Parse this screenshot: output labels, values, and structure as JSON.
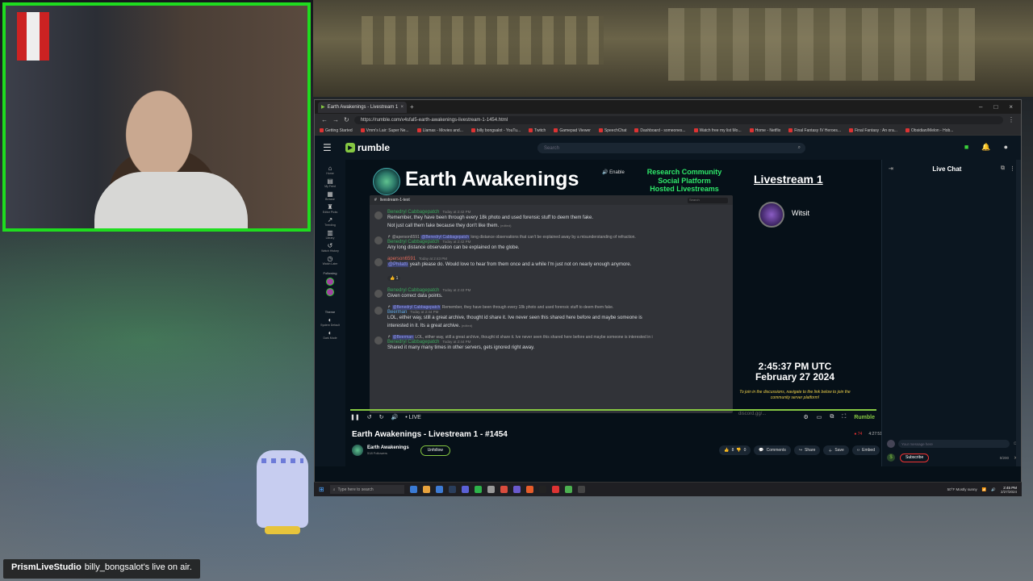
{
  "overlay": {
    "notice_app": "PrismLiveStudio",
    "notice_text": "billy_bongsalot's live on air."
  },
  "browser": {
    "tab_title": "Earth Awakenings - Livestream 1",
    "url": "https://rumble.com/v4sfal5-earth-awakenings-livestream-1-1454.html",
    "bookmarks": [
      "Getting Started",
      "Vmm's Lair: Super Ne...",
      "Llamas - Movies and...",
      "billy bongsalot - YouTu...",
      "Twitch",
      "Gamepad Viewer",
      "SpeechChat",
      "Dashboard - someones...",
      "Watch free my list Mo...",
      "Home - Netflix",
      "Final Fantasy IV Heroes...",
      "Final Fantasy : An ora...",
      "Obsidian/Melon - Hob..."
    ]
  },
  "rumble": {
    "logo": "rumble",
    "search_placeholder": "Search",
    "nav": [
      {
        "icon": "home-icon",
        "glyph": "⌂",
        "label": "Home"
      },
      {
        "icon": "library-icon",
        "glyph": "▤",
        "label": "My Feed"
      },
      {
        "icon": "browse-icon",
        "glyph": "▦",
        "label": "Browse"
      },
      {
        "icon": "editor-icon",
        "glyph": "♜",
        "label": "Editor Picks"
      },
      {
        "icon": "trending-icon",
        "glyph": "↗",
        "label": "Trending"
      },
      {
        "icon": "library2-icon",
        "glyph": "▥",
        "label": "Library"
      },
      {
        "icon": "history-icon",
        "glyph": "↺",
        "label": "Watch History"
      },
      {
        "icon": "later-icon",
        "glyph": "◷",
        "label": "Watch Later"
      }
    ],
    "following_label": "Following",
    "theme_label": "Theme",
    "theme_items": [
      "System Default",
      "Dark Mode"
    ]
  },
  "stream": {
    "banner_title": "Earth Awakenings",
    "enable_label": "Enable",
    "research_lines": [
      "Research Community",
      "Social Platform",
      "Hosted Livestreams"
    ],
    "livestream_label": "Livestream 1",
    "host_name": "Witsit",
    "clock_time": "2:45:37 PM UTC",
    "clock_date": "February 27 2024",
    "join_info": "To join in the discussions, navigate to the link below to join the community server platform!",
    "discord_link": "discord.gg/..."
  },
  "discord": {
    "channel": "livestream-1-text",
    "search": "Search",
    "messages": [
      {
        "reply": "",
        "author": "Benedryl Cabbagepatch",
        "author_class": "",
        "time": "Today at 2:42 PM",
        "lines": [
          "Remember, they have been through every 18k photo and used forensic stuff to deem them fake.",
          "Not just call them fake because they don't like them."
        ],
        "edited": "(edited)"
      },
      {
        "reply_prefix": "@aperson6591",
        "reply_mention": "@Benedryl Cabbagepatch",
        "reply_text": "long distance observations that can't be explained away by a misunderstanding of refraction.",
        "author": "Benedryl Cabbagepatch",
        "author_class": "",
        "time": "Today at 2:42 PM",
        "lines": [
          "Any long distance observation can be explained on the globe."
        ]
      },
      {
        "reply": "",
        "author": "aperson6591",
        "author_class": "p",
        "time": "Today at 2:43 PM",
        "mention": "@Philatti",
        "lines": [
          "yeah please do. Would love to hear from them once and a while I'm just not on nearly enough anymore."
        ],
        "reaction": "👍 1"
      },
      {
        "reply": "",
        "author": "Benedryl Cabbagepatch",
        "author_class": "",
        "time": "Today at 2:43 PM",
        "lines": [
          "Given correct data points."
        ]
      },
      {
        "reply_prefix": "",
        "reply_mention": "@Benedryl Cabbagepatch",
        "reply_text": "Remember, they have been through every 18k photo and used forensic stuff to deem them fake.",
        "author": "Beerman",
        "author_class": "b",
        "time": "Today at 2:44 PM",
        "lines": [
          "LOL, either way, still a great archive, thought id share it. Ive never seen this shared here before and maybe someone is",
          "interested in it. Its a great archive."
        ],
        "edited": "(edited)"
      },
      {
        "reply_prefix": "",
        "reply_mention": "@Beerman",
        "reply_text": "LOL, either way, still a great archive, thought id share it. Ive never seen this shared here before and maybe someone is interested in i",
        "author": "Benedryl Cabbagepatch",
        "author_class": "",
        "time": "Today at 2:44 PM",
        "lines": [
          "Shared it many many times in other servers, gets ignored right away."
        ]
      }
    ]
  },
  "player": {
    "live_label": "LIVE",
    "rumble_mark": "Rumble",
    "progress": 1.0
  },
  "video": {
    "title": "Earth Awakenings - Livestream 1 - #1454",
    "viewers": "74",
    "uptime": "4:27:51",
    "channel_name": "Earth Awakenings",
    "followers": "518 Followers",
    "unfollow_label": "Unfollow",
    "likes": "8",
    "dislikes": "0",
    "actions": [
      "Comments",
      "Share",
      "Save",
      "Embed"
    ]
  },
  "chat": {
    "title": "Live Chat",
    "placeholder": "Your message here",
    "subscribe_label": "Subscribe",
    "char_count": "0/200"
  },
  "taskbar": {
    "search_placeholder": "Type here to search",
    "weather": "50°F  Mostly sunny",
    "time": "2:45 PM",
    "date": "2/27/2024"
  }
}
